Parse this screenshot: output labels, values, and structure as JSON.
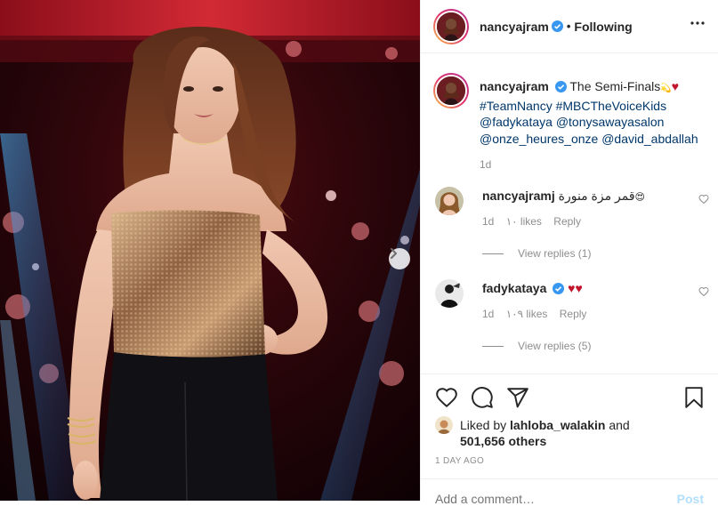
{
  "post": {
    "username": "nancyajram",
    "follow_status": "Following",
    "separator": "•",
    "more_icon": "more-horizontal-icon",
    "photo_next_icon": "chevron-right-icon"
  },
  "caption": {
    "username": "nancyajram",
    "text": "The Semi-Finals",
    "emoji": "💫",
    "heart": "♥",
    "hashtags": [
      "#TeamNancy",
      "#MBCTheVoiceKids"
    ],
    "mentions_line1": [
      "@fadykataya",
      "@tonysawayasalon"
    ],
    "mentions_line2": [
      "@onze_heures_onze",
      "@david_abdallah"
    ],
    "time": "1d"
  },
  "comments": [
    {
      "username": "nancyajramj",
      "text": "قمر مزة منورة",
      "emoji": "😍",
      "time": "1d",
      "likes": "١٠ likes",
      "reply": "Reply",
      "view_replies": "View replies (1)"
    },
    {
      "username": "fadykataya",
      "verified": true,
      "text": "♥♥",
      "time": "1d",
      "likes": "١٠٩ likes",
      "reply": "Reply",
      "view_replies": "View replies (5)"
    }
  ],
  "actions": {
    "like_icon": "heart-icon",
    "comment_icon": "comment-icon",
    "share_icon": "paper-plane-icon",
    "save_icon": "bookmark-icon"
  },
  "likes": {
    "prefix": "Liked by",
    "first_user": "lahloba_walakin",
    "and": "and",
    "others": "501,656 others"
  },
  "date": "1 DAY AGO",
  "add_comment": {
    "placeholder": "Add a comment…",
    "post_label": "Post"
  },
  "colors": {
    "verified_blue": "#3897f0",
    "heart_red": "#c0152b",
    "link_navy": "#00376b",
    "muted_gray": "#8e8e8e",
    "post_button_disabled": "#b2dffc"
  }
}
